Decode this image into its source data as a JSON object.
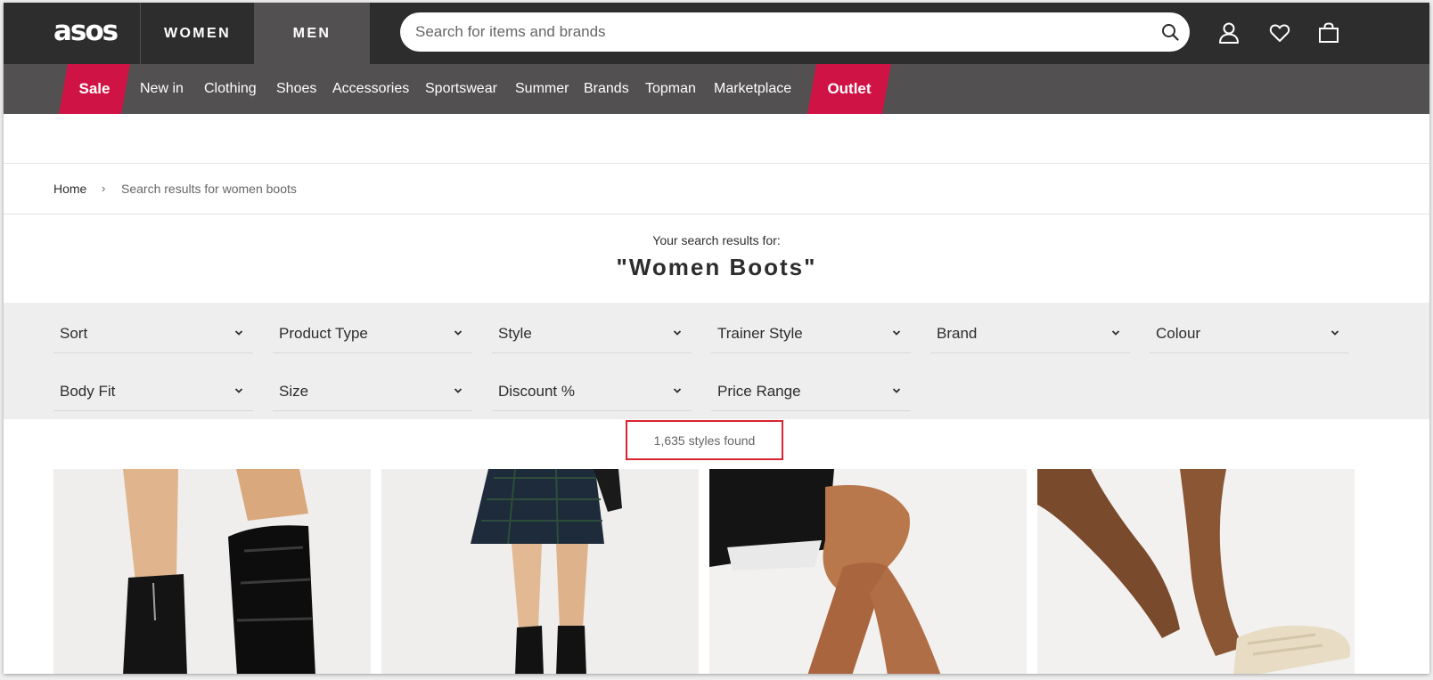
{
  "header": {
    "logo": "asos",
    "tabs": [
      {
        "label": "WOMEN"
      },
      {
        "label": "MEN",
        "active": true
      }
    ],
    "search": {
      "placeholder": "Search for items and brands",
      "value": ""
    },
    "icons": [
      "search-icon",
      "account-icon",
      "heart-icon",
      "bag-icon"
    ]
  },
  "nav": {
    "sale": "Sale",
    "items": [
      "New in",
      "Clothing",
      "Shoes",
      "Accessories",
      "Sportswear",
      "Summer",
      "Brands",
      "Topman",
      "Marketplace"
    ],
    "outlet": "Outlet",
    "promo_color": "#d01345"
  },
  "breadcrumb": {
    "home": "Home",
    "separator": "›",
    "current": "Search results for women boots"
  },
  "results": {
    "label": "Your search results for:",
    "query": "\"Women Boots\"",
    "count": "1,635 styles found"
  },
  "filters": [
    {
      "label": "Sort"
    },
    {
      "label": "Product Type"
    },
    {
      "label": "Style"
    },
    {
      "label": "Trainer Style"
    },
    {
      "label": "Brand"
    },
    {
      "label": "Colour"
    },
    {
      "label": "Body Fit"
    },
    {
      "label": "Size"
    },
    {
      "label": "Discount %"
    },
    {
      "label": "Price Range"
    }
  ],
  "products": [
    {
      "image": "black-croc-ankle-boots"
    },
    {
      "image": "black-knee-boots-plaid-skirt"
    },
    {
      "image": "legs-black-shorts"
    },
    {
      "image": "legs-cream-boot"
    }
  ],
  "colors": {
    "header_bg": "#2d2d2d",
    "nav_bg": "#525050",
    "filter_bg": "#eeeeee",
    "highlight_border": "#d9232e"
  }
}
